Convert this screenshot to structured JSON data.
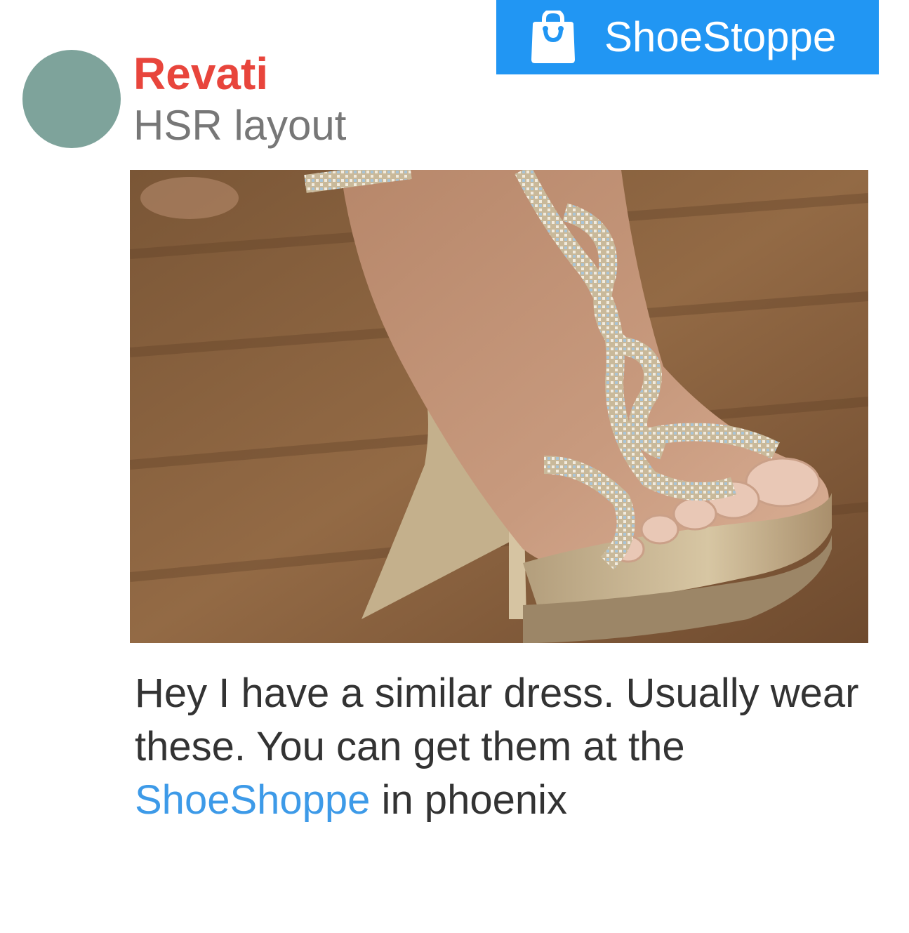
{
  "shop_badge": {
    "name": "ShoeStoppe",
    "icon": "shopping-bag-icon",
    "background_color": "#2196f3"
  },
  "post": {
    "author": {
      "name": "Revati",
      "location": "HSR layout",
      "name_color": "#e8453c",
      "avatar_color": "#7ea39b"
    },
    "message": {
      "before_link": "Hey I have a similar dress. Usually wear these. You can get them at the ",
      "link_text": "ShoeShoppe",
      "after_link": " in phoenix",
      "link_color": "#3d9ae8"
    }
  }
}
